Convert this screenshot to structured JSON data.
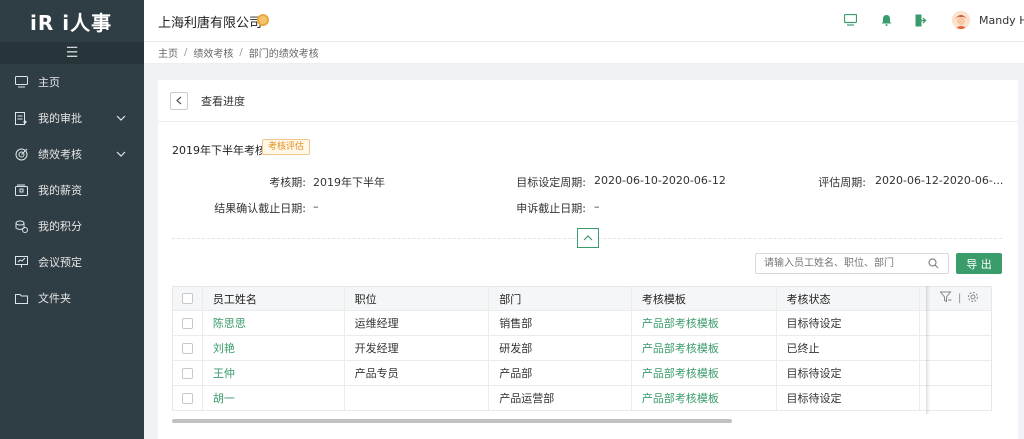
{
  "app": {
    "logo": "iR i人事"
  },
  "sidebar": {
    "toggle_icon": "hamburger-icon",
    "items": [
      {
        "label": "主页",
        "icon": "monitor-icon"
      },
      {
        "label": "我的审批",
        "icon": "approval-icon",
        "has_children": true
      },
      {
        "label": "绩效考核",
        "icon": "target-icon",
        "has_children": true
      },
      {
        "label": "我的薪资",
        "icon": "wallet-icon"
      },
      {
        "label": "我的积分",
        "icon": "coins-icon"
      },
      {
        "label": "会议预定",
        "icon": "presentation-icon"
      },
      {
        "label": "文件夹",
        "icon": "folder-icon"
      }
    ]
  },
  "header": {
    "company": "上海利唐有限公司",
    "user_name": "Mandy Hu"
  },
  "breadcrumb": [
    "主页",
    "绩效考核",
    "部门的绩效考核"
  ],
  "page": {
    "title": "查看进度",
    "evaluation_name": "2019年下半年考核",
    "evaluation_tag": "考核评估",
    "info": {
      "period_label": "考核期:",
      "period_value": "2019年下半年",
      "target_label": "目标设定周期:",
      "target_value": "2020-06-10-2020-06-12",
      "assess_label": "评估周期:",
      "assess_value": "2020-06-12-2020-06-...",
      "confirm_label": "结果确认截止日期:",
      "confirm_value": "–",
      "appeal_label": "申诉截止日期:",
      "appeal_value": "–"
    },
    "search_placeholder": "请输入员工姓名、职位、部门",
    "export_label": "导 出"
  },
  "table": {
    "columns": [
      "员工姓名",
      "职位",
      "部门",
      "考核模板",
      "考核状态"
    ],
    "rows": [
      {
        "name": "陈思思",
        "position": "运维经理",
        "dept": "销售部",
        "template": "产品部考核模板",
        "status": "目标待设定"
      },
      {
        "name": "刘艳",
        "position": "开发经理",
        "dept": "研发部",
        "template": "产品部考核模板",
        "status": "已终止"
      },
      {
        "name": "王仲",
        "position": "产品专员",
        "dept": "产品部",
        "template": "产品部考核模板",
        "status": "目标待设定"
      },
      {
        "name": "胡一",
        "position": "",
        "dept": "产品运营部",
        "template": "产品部考核模板",
        "status": "目标待设定"
      }
    ]
  },
  "colors": {
    "accent": "#3a9b6b",
    "sidebar_bg": "#2f3e44",
    "tag": "#e58f1d"
  }
}
